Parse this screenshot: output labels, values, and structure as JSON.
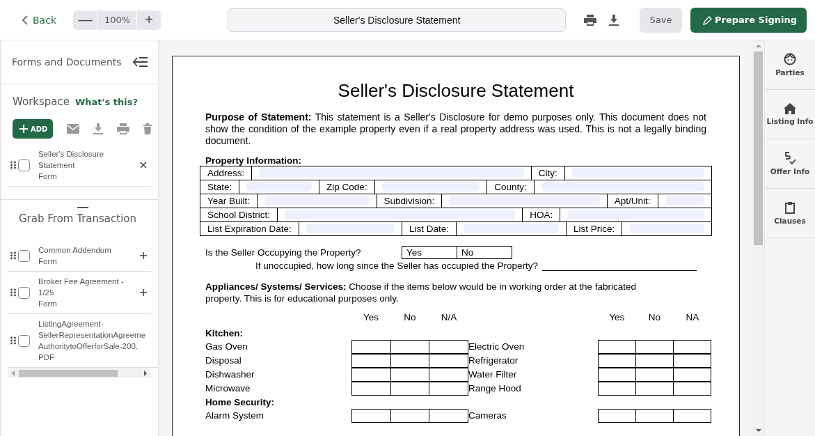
{
  "toolbar": {
    "back": "Back",
    "zoom_out": "—",
    "zoom": "100%",
    "zoom_in": "+",
    "document_title": "Seller's Disclosure Statement",
    "save": "Save",
    "prepare": "Prepare Signing"
  },
  "sidebar": {
    "title": "Forms and Documents",
    "workspace": {
      "title": "Workspace",
      "help_link": "What's this?",
      "add": "ADD",
      "items": [
        {
          "lines": [
            "Seller's Disclosure Statement"
          ],
          "type": "Form",
          "checked": false,
          "kind": "removable"
        }
      ]
    },
    "transaction": {
      "title": "Grab From Transaction",
      "items": [
        {
          "lines": [
            "Common Addendum"
          ],
          "type": "Form",
          "checked": false,
          "kind": "addable"
        },
        {
          "lines": [
            "Broker Fee Agreement - 1/25"
          ],
          "type": "Form",
          "checked": false,
          "kind": "addable"
        },
        {
          "lines": [
            "ListingAgreement-",
            "SellerRepresentationAgreeme",
            "AuthoritytoOfferforSale-200."
          ],
          "type": "PDF",
          "checked": false,
          "kind": "plain"
        }
      ]
    }
  },
  "document": {
    "title": "Seller's Disclosure Statement",
    "purpose": "**Purpose of Statement:** This statement is a Seller's Disclosure for demo purposes only. This document does not show the condition of the example property even if a real property address was used. This is not a legally binding document.",
    "property_heading": "Property Information:",
    "property_rows": [
      [
        {
          "kind": "label",
          "text": "Address:"
        },
        {
          "kind": "field"
        },
        {
          "kind": "label",
          "text": "City:"
        },
        {
          "kind": "field"
        }
      ],
      [
        {
          "kind": "label",
          "text": "State:"
        },
        {
          "kind": "field"
        },
        {
          "kind": "label",
          "text": "Zip Code:"
        },
        {
          "kind": "field"
        },
        {
          "kind": "label",
          "text": "County:"
        },
        {
          "kind": "field"
        }
      ],
      [
        {
          "kind": "label",
          "text": "Year Built:"
        },
        {
          "kind": "field"
        },
        {
          "kind": "label",
          "text": "Subdivision:"
        },
        {
          "kind": "field"
        },
        {
          "kind": "label",
          "text": "Apt/Unit:"
        },
        {
          "kind": "field"
        }
      ],
      [
        {
          "kind": "label",
          "text": "School District:"
        },
        {
          "kind": "field"
        },
        {
          "kind": "label",
          "text": "HOA:"
        },
        {
          "kind": "field"
        }
      ],
      [
        {
          "kind": "label",
          "text": "List Expiration Date:"
        },
        {
          "kind": "field"
        },
        {
          "kind": "label",
          "text": "List Date:"
        },
        {
          "kind": "field"
        },
        {
          "kind": "label",
          "text": "List Price:"
        },
        {
          "kind": "field"
        }
      ]
    ],
    "occupancy_question": "Is the Seller Occupying the Property?",
    "occupancy_options": [
      "Yes",
      "No"
    ],
    "unoccupied_question": "If unoccupied, how long since the Seller has occupied the Property?",
    "appliances_intro": "**Appliances/ Systems/ Services:** Choose if the items below would be in working order at the fabricated property. This is for educational purposes only.",
    "headers_left": [
      "Yes",
      "No",
      "N/A"
    ],
    "headers_right": [
      "Yes",
      "No",
      "NA"
    ],
    "sections": [
      {
        "title": "Kitchen:",
        "rows": [
          {
            "left": "Gas Oven",
            "right": "Electric Oven"
          },
          {
            "left": "Disposal",
            "right": "Refrigerator"
          },
          {
            "left": "Dishwasher",
            "right": "Water Filter"
          },
          {
            "left": "Microwave",
            "right": "Range Hood"
          }
        ]
      },
      {
        "title": "Home Security:",
        "rows": [
          {
            "left": "Alarm System",
            "right": "Cameras"
          }
        ]
      }
    ]
  },
  "right_panel": [
    {
      "kind": "parties",
      "label": "Parties"
    },
    {
      "kind": "listing",
      "label": "Listing Info"
    },
    {
      "kind": "offer",
      "label": "Offer Info"
    },
    {
      "kind": "clauses",
      "label": "Clauses"
    }
  ]
}
